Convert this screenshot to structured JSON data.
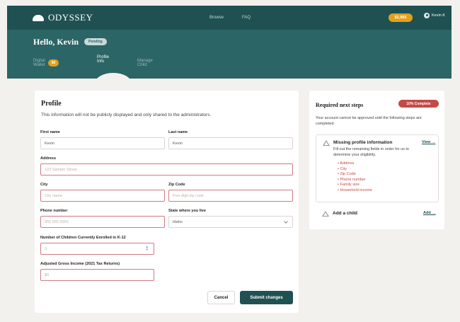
{
  "brand": {
    "name": "ODYSSEY"
  },
  "nav": {
    "items": [
      "Browse",
      "FAQ"
    ]
  },
  "header_right": {
    "balance": "$2,955",
    "user_name": "Kevin K"
  },
  "header": {
    "greeting": "Hello, Kevin",
    "status_badge": "Pending",
    "tabs": [
      {
        "label": "Digital Wallet",
        "badge": "$0"
      },
      {
        "label": "Profile Info",
        "active": true
      },
      {
        "label": "Manage Child"
      }
    ]
  },
  "profile": {
    "title": "Profile",
    "description": "This information will not be publicly displayed and only shared to the administrators.",
    "fields": {
      "first_name": {
        "label": "First name",
        "value": "Kevin"
      },
      "last_name": {
        "label": "Last name",
        "value": "Kevin"
      },
      "address": {
        "label": "Address",
        "placeholder": "123 Sample Street"
      },
      "city": {
        "label": "City",
        "placeholder": "City name"
      },
      "zip": {
        "label": "Zip Code",
        "placeholder": "Five digit zip code"
      },
      "phone": {
        "label": "Phone number",
        "placeholder": "555 555 5555"
      },
      "state": {
        "label": "State where you live",
        "value": "Idaho"
      },
      "children": {
        "label": "Number of Children Currently Enrolled in K-12",
        "placeholder": "0"
      },
      "income": {
        "label": "Adjusted Gross Income (2021 Tax Returns)",
        "placeholder": "$0"
      }
    },
    "cancel_label": "Cancel",
    "submit_label": "Submit changes"
  },
  "next_steps": {
    "title": "Required next steps",
    "complete_badge": "10% Complete",
    "description": "Your account cannot be approved until the following steps are completed.",
    "steps": [
      {
        "title": "Missing profile information",
        "link": "View →",
        "description": "Fill out the remaining fields in order for us to determine your eligibility.",
        "missing": [
          "Address",
          "City",
          "Zip Code",
          "Phone number",
          "Family size",
          "Household income"
        ]
      },
      {
        "title": "Add a child",
        "link": "Add →"
      }
    ]
  },
  "colors": {
    "primary": "#1f5152",
    "header": "#2c6566",
    "accent": "#e2a11d",
    "error": "#c54a45"
  }
}
